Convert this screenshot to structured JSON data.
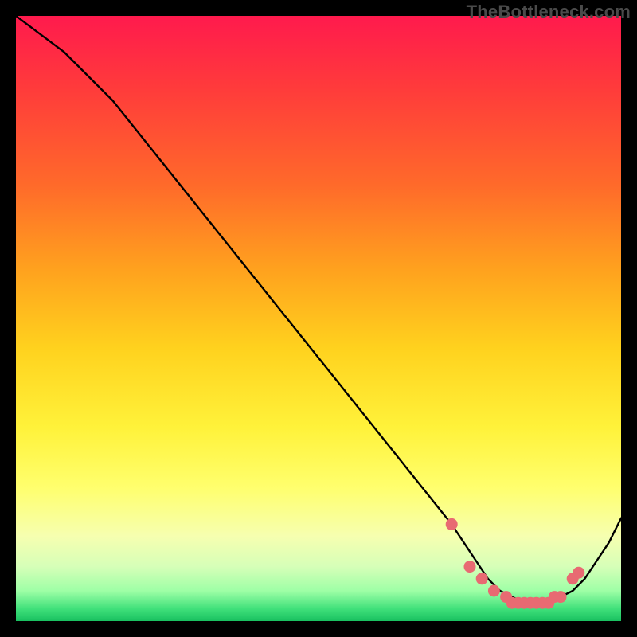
{
  "watermark": "TheBottleneck.com",
  "colors": {
    "curve_stroke": "#000000",
    "dot_fill": "#e86a72",
    "dot_stroke": "#e86a72"
  },
  "chart_data": {
    "type": "line",
    "title": "",
    "xlabel": "",
    "ylabel": "",
    "xlim": [
      0,
      100
    ],
    "ylim": [
      0,
      100
    ],
    "grid": false,
    "legend": false,
    "series": [
      {
        "name": "bottleneck-curve",
        "x": [
          0,
          4,
          8,
          12,
          16,
          20,
          24,
          28,
          32,
          36,
          40,
          44,
          48,
          52,
          56,
          60,
          64,
          68,
          72,
          74,
          76,
          78,
          80,
          82,
          84,
          86,
          88,
          90,
          92,
          94,
          96,
          98,
          100
        ],
        "y": [
          100,
          97,
          94,
          90,
          86,
          81,
          76,
          71,
          66,
          61,
          56,
          51,
          46,
          41,
          36,
          31,
          26,
          21,
          16,
          13,
          10,
          7,
          5,
          4,
          3,
          3,
          3,
          4,
          5,
          7,
          10,
          13,
          17
        ]
      }
    ],
    "highlight_points": {
      "series": "bottleneck-curve",
      "x": [
        72,
        75,
        77,
        79,
        81,
        82,
        83,
        84,
        85,
        86,
        87,
        88,
        89,
        90,
        92,
        93
      ],
      "y": [
        16,
        9,
        7,
        5,
        4,
        3,
        3,
        3,
        3,
        3,
        3,
        3,
        4,
        4,
        7,
        8
      ]
    }
  }
}
